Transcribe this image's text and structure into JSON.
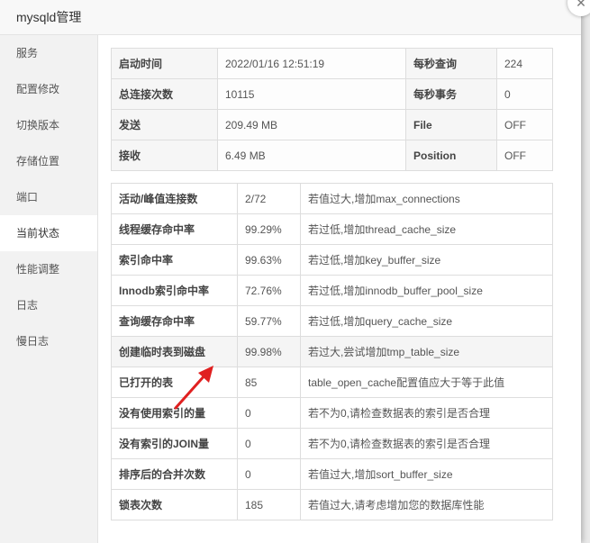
{
  "window": {
    "title": "mysqld管理",
    "close_icon": "close-icon"
  },
  "sidebar": {
    "items": [
      {
        "label": "服务"
      },
      {
        "label": "配置修改"
      },
      {
        "label": "切换版本"
      },
      {
        "label": "存储位置"
      },
      {
        "label": "端口"
      },
      {
        "label": "当前状态",
        "active": true
      },
      {
        "label": "性能调整"
      },
      {
        "label": "日志"
      },
      {
        "label": "慢日志"
      }
    ]
  },
  "summary": {
    "rows": [
      {
        "label1": "启动时间",
        "value1": "2022/01/16 12:51:19",
        "label2": "每秒查询",
        "value2": "224"
      },
      {
        "label1": "总连接次数",
        "value1": "10115",
        "label2": "每秒事务",
        "value2": "0"
      },
      {
        "label1": "发送",
        "value1": "209.49 MB",
        "label2": "File",
        "value2": "OFF"
      },
      {
        "label1": "接收",
        "value1": "6.49 MB",
        "label2": "Position",
        "value2": "OFF"
      }
    ]
  },
  "status": {
    "rows": [
      {
        "name": "活动/峰值连接数",
        "value": "2/72",
        "tip": "若值过大,增加max_connections"
      },
      {
        "name": "线程缓存命中率",
        "value": "99.29%",
        "tip": "若过低,增加thread_cache_size"
      },
      {
        "name": "索引命中率",
        "value": "99.63%",
        "tip": "若过低,增加key_buffer_size"
      },
      {
        "name": "Innodb索引命中率",
        "value": "72.76%",
        "tip": "若过低,增加innodb_buffer_pool_size"
      },
      {
        "name": "查询缓存命中率",
        "value": "59.77%",
        "tip": "若过低,增加query_cache_size"
      },
      {
        "name": "创建临时表到磁盘",
        "value": "99.98%",
        "tip": "若过大,尝试增加tmp_table_size",
        "highlighted": true
      },
      {
        "name": "已打开的表",
        "value": "85",
        "tip": "table_open_cache配置值应大于等于此值"
      },
      {
        "name": "没有使用索引的量",
        "value": "0",
        "tip": "若不为0,请检查数据表的索引是否合理"
      },
      {
        "name": "没有索引的JOIN量",
        "value": "0",
        "tip": "若不为0,请检查数据表的索引是否合理"
      },
      {
        "name": "排序后的合并次数",
        "value": "0",
        "tip": "若值过大,增加sort_buffer_size"
      },
      {
        "name": "锁表次数",
        "value": "185",
        "tip": "若值过大,请考虑增加您的数据库性能"
      }
    ]
  },
  "annotation": {
    "arrow_color": "#e02020",
    "arrow_icon": "red-arrow-icon"
  }
}
